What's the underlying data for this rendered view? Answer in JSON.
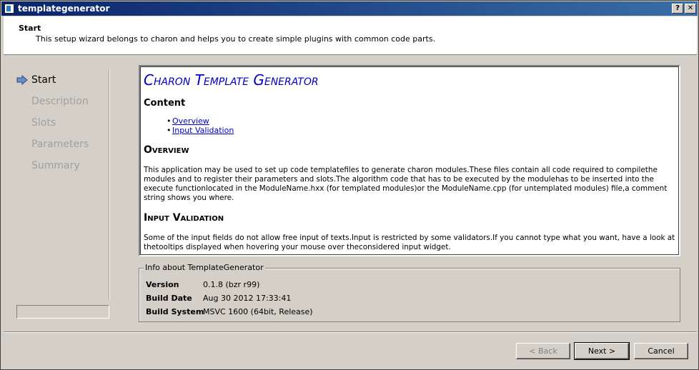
{
  "window": {
    "title": "templategenerator",
    "help_label": "?",
    "close_label": "✕"
  },
  "header": {
    "title": "Start",
    "subtitle": "This setup wizard belongs to charon and helps you to create simple plugins with common code parts."
  },
  "nav": {
    "items": [
      {
        "label": "Start"
      },
      {
        "label": "Description"
      },
      {
        "label": "Slots"
      },
      {
        "label": "Parameters"
      },
      {
        "label": "Summary"
      }
    ]
  },
  "doc": {
    "title": "Charon Template Generator",
    "content_heading": "Content",
    "toc": [
      {
        "label": "Overview"
      },
      {
        "label": "Input Validation"
      }
    ],
    "overview_heading": "Overview",
    "overview_text": "This application may be used to set up code templatefiles to generate charon modules.These files contain all code required to compilethe modules and to register their parameters and slots.The algorithm code that has to be executed by the modulehas to be inserted into the execute functionlocated in the ModuleName.hxx (for templated modules)or the ModuleName.cpp (for untemplated modules) file,a comment string shows you where.",
    "validation_heading": "Input Validation",
    "validation_text": "Some of the input fields do not allow free input of texts.Input is restricted by some validators.If you cannot type what you want, have a look at thetooltips displayed when hovering your mouse over theconsidered input widget."
  },
  "info": {
    "group_title": "Info about TemplateGenerator",
    "rows": [
      {
        "key": "Version",
        "value": "0.1.8 (bzr r99)"
      },
      {
        "key": "Build Date",
        "value": "Aug 30 2012 17:33:41"
      },
      {
        "key": "Build System",
        "value": "MSVC 1600 (64bit, Release)"
      }
    ]
  },
  "buttons": {
    "back": "< Back",
    "next": "Next >",
    "cancel": "Cancel"
  }
}
